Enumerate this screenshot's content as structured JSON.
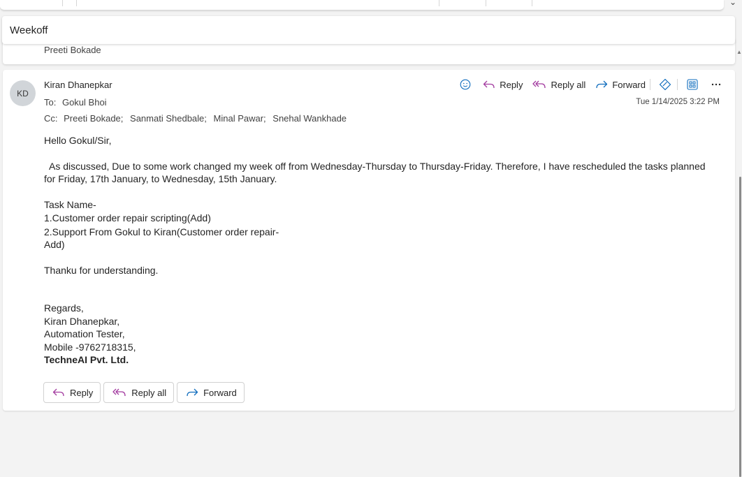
{
  "subject": "Weekoff",
  "collapsed_sender": "Preeti Bokade",
  "message": {
    "avatar_initials": "KD",
    "sender": "Kiran Dhanepkar",
    "to_label": "To:",
    "to": "Gokul Bhoi",
    "cc_label": "Cc:",
    "cc": [
      "Preeti Bokade;",
      "Sanmati Shedbale;",
      "Minal Pawar;",
      "Snehal Wankhade"
    ],
    "date": "Tue 1/14/2025 3:22 PM",
    "body": {
      "greeting": "Hello Gokul/Sir,",
      "para1_line1": "  As discussed, Due to some work changed my week off from Wednesday-Thursday to Thursday-Friday. Therefore, I have rescheduled the tasks planned",
      "para1_line2": "for Friday, 17th January, to Wednesday, 15th January.",
      "task_header": "Task Name-",
      "task1": "1.Customer order repair scripting(Add)",
      "task2_line1": "2.Support From Gokul to Kiran(Customer order repair-",
      "task2_line2": "Add)",
      "thanks": "Thanku for understanding.",
      "regards": "Regards,",
      "sig_name": "Kiran Dhanepkar,",
      "sig_title": "Automation Tester,",
      "sig_mobile": "Mobile -9762718315,",
      "sig_company": "TechneAI Pvt. Ltd."
    }
  },
  "toolbar": {
    "reply": "Reply",
    "reply_all": "Reply all",
    "forward": "Forward"
  },
  "bottom_buttons": {
    "reply": "Reply",
    "reply_all": "Reply all",
    "forward": "Forward"
  },
  "icons": {
    "emoji": "smiley-icon",
    "reply": "reply-arrow-icon",
    "reply_all": "reply-all-icon",
    "forward": "forward-arrow-icon",
    "loop": "loop-icon",
    "apps": "apps-grid-icon",
    "more": "more-ellipsis-icon"
  },
  "colors": {
    "reply_accent": "#a33ca0",
    "forward_accent": "#0f6cbd",
    "app_accent": "#0f6cbd"
  }
}
